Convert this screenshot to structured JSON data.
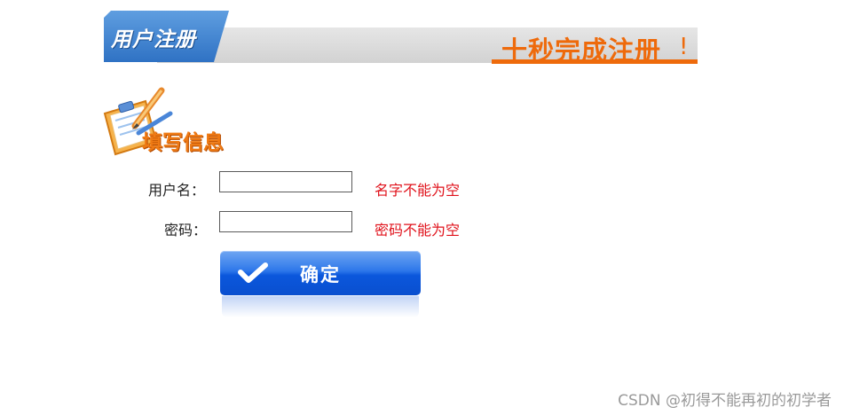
{
  "banner": {
    "tab_label": "用户注册",
    "slogan": "十秒完成注册",
    "slogan_mark": "!"
  },
  "section": {
    "title": "填写信息",
    "icon": "clipboard-pencil-icon"
  },
  "form": {
    "username": {
      "label": "用户名：",
      "value": "",
      "error": "名字不能为空"
    },
    "password": {
      "label": "密码：",
      "value": "",
      "error": "密码不能为空"
    },
    "submit": {
      "label": "确定",
      "icon": "checkmark-icon"
    }
  },
  "watermark": "CSDN @初得不能再初的初学者",
  "colors": {
    "accent_orange": "#ee6a0b",
    "banner_blue": "#2f72c4",
    "button_blue": "#0b57dc",
    "error_red": "#e0121b"
  }
}
